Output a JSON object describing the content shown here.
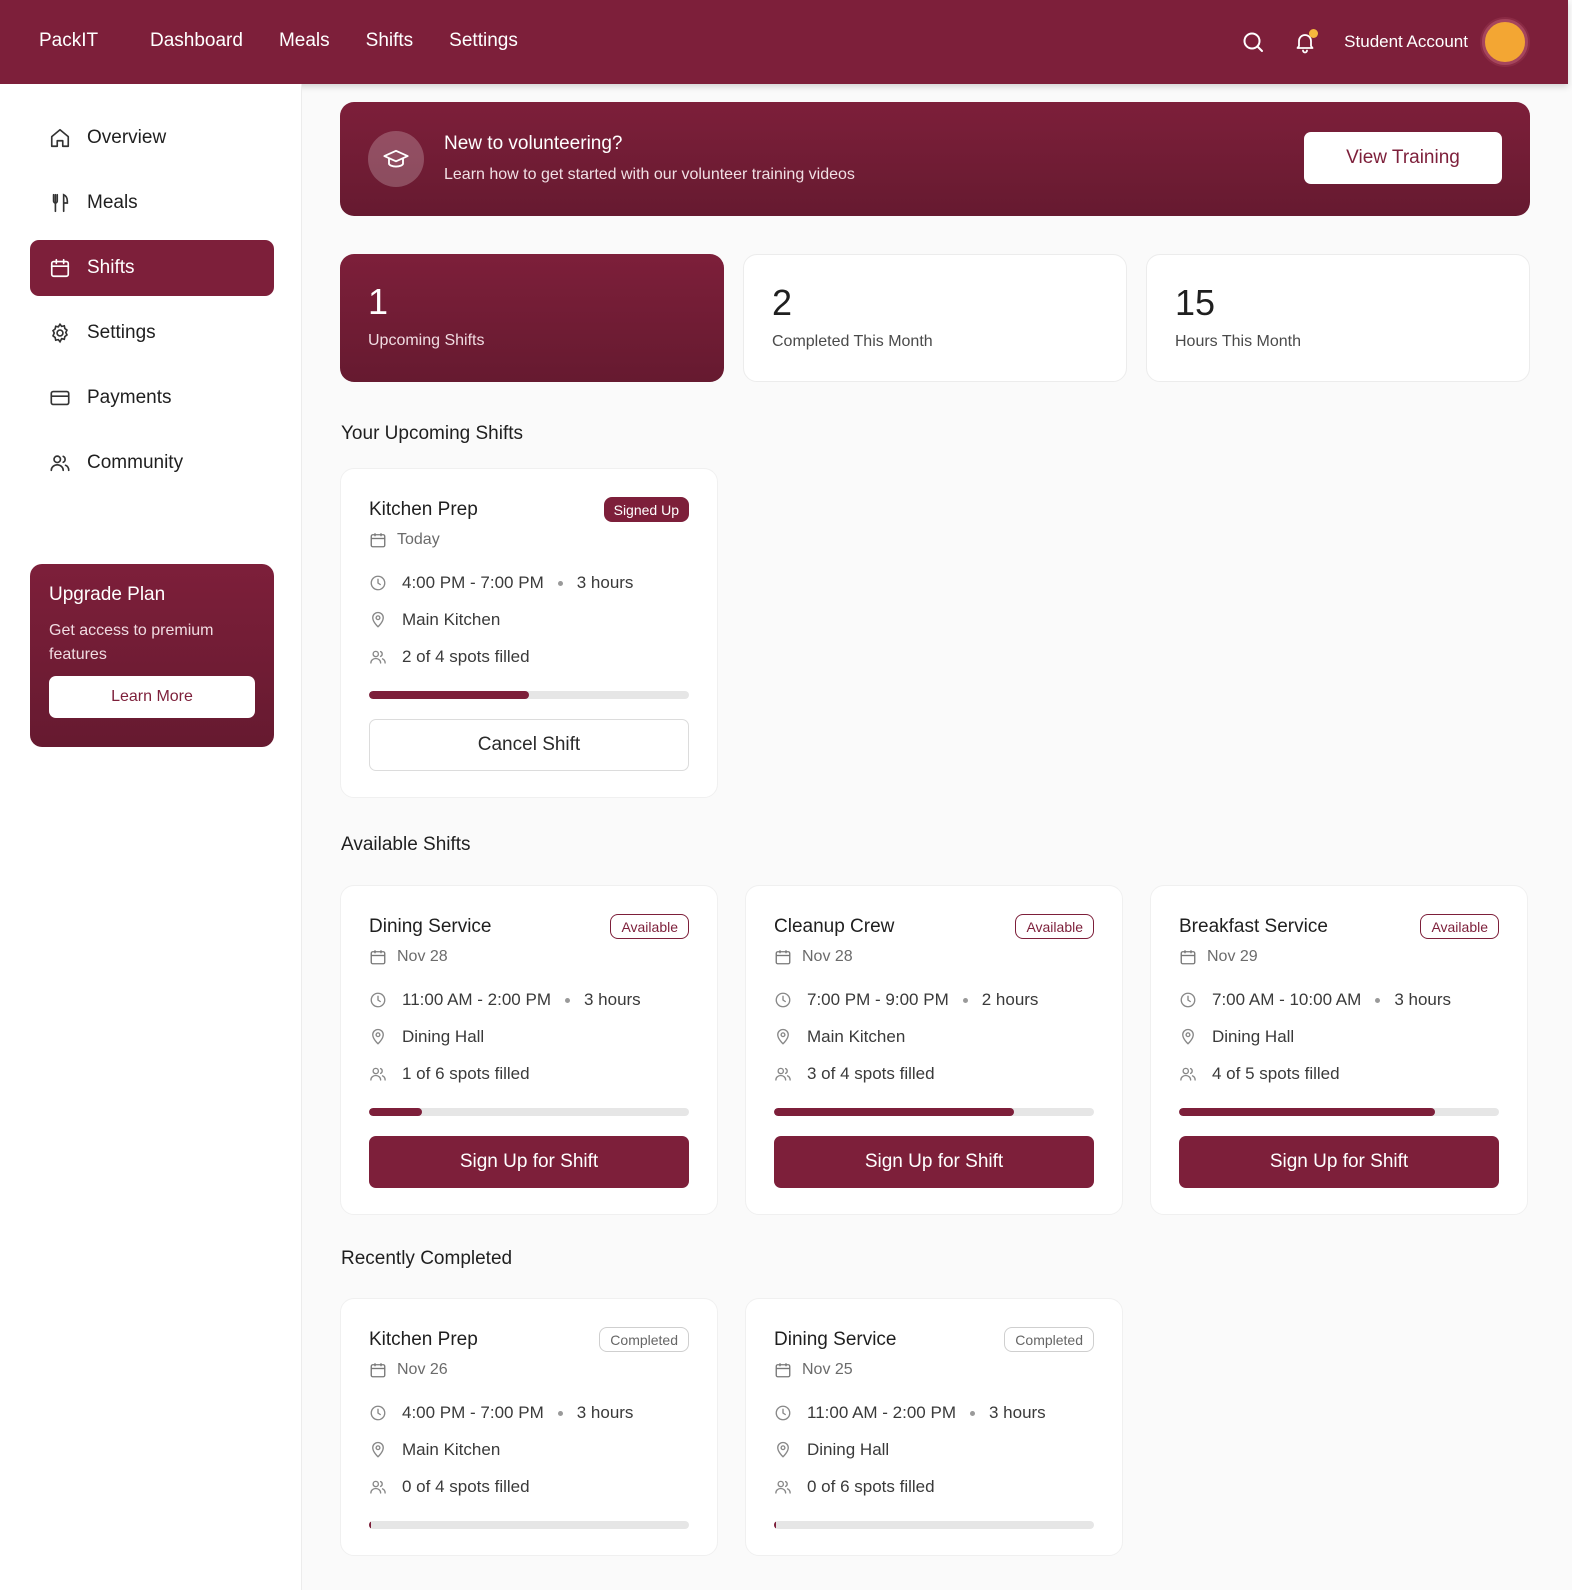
{
  "brand": "PackIT",
  "topnav": [
    "Dashboard",
    "Meals",
    "Shifts",
    "Settings"
  ],
  "account": {
    "name": "Student Account",
    "avatar_color": "#f3a633",
    "notification_dot_color": "#f5b83d"
  },
  "colors": {
    "accent": "#7d1f3a"
  },
  "sidebar": {
    "items": [
      {
        "label": "Overview",
        "icon": "home-icon"
      },
      {
        "label": "Meals",
        "icon": "utensils-icon"
      },
      {
        "label": "Shifts",
        "icon": "calendar-icon",
        "active": true
      },
      {
        "label": "Settings",
        "icon": "gear-icon"
      },
      {
        "label": "Payments",
        "icon": "credit-card-icon"
      },
      {
        "label": "Community",
        "icon": "users-icon"
      }
    ],
    "upgrade": {
      "title": "Upgrade Plan",
      "text": "Get access to premium features",
      "button": "Learn More"
    }
  },
  "banner": {
    "title": "New to volunteering?",
    "subtitle": "Learn how to get started with our volunteer training videos",
    "button": "View Training",
    "icon": "graduation-cap-icon"
  },
  "stats": [
    {
      "value": "1",
      "label": "Upcoming Shifts"
    },
    {
      "value": "2",
      "label": "Completed This Month"
    },
    {
      "value": "15",
      "label": "Hours This Month"
    }
  ],
  "sections": {
    "upcoming": "Your Upcoming Shifts",
    "available": "Available Shifts",
    "completed": "Recently Completed"
  },
  "upcoming_shifts": [
    {
      "title": "Kitchen Prep",
      "badge": "Signed Up",
      "date": "Today",
      "time": "4:00 PM - 7:00 PM",
      "duration": "3 hours",
      "location": "Main Kitchen",
      "spots": "2 of 4 spots filled",
      "fill": 0.5,
      "button": "Cancel Shift"
    }
  ],
  "available_shifts": [
    {
      "title": "Dining Service",
      "badge": "Available",
      "date": "Nov 28",
      "time": "11:00 AM - 2:00 PM",
      "duration": "3 hours",
      "location": "Dining Hall",
      "spots": "1 of 6 spots filled",
      "fill": 0.1667,
      "button": "Sign Up for Shift"
    },
    {
      "title": "Cleanup Crew",
      "badge": "Available",
      "date": "Nov 28",
      "time": "7:00 PM - 9:00 PM",
      "duration": "2 hours",
      "location": "Main Kitchen",
      "spots": "3 of 4 spots filled",
      "fill": 0.75,
      "button": "Sign Up for Shift"
    },
    {
      "title": "Breakfast Service",
      "badge": "Available",
      "date": "Nov 29",
      "time": "7:00 AM - 10:00 AM",
      "duration": "3 hours",
      "location": "Dining Hall",
      "spots": "4 of 5 spots filled",
      "fill": 0.8,
      "button": "Sign Up for Shift"
    }
  ],
  "completed_shifts": [
    {
      "title": "Kitchen Prep",
      "badge": "Completed",
      "date": "Nov 26",
      "time": "4:00 PM - 7:00 PM",
      "duration": "3 hours",
      "location": "Main Kitchen",
      "spots": "0 of 4 spots filled",
      "fill": 0
    },
    {
      "title": "Dining Service",
      "badge": "Completed",
      "date": "Nov 25",
      "time": "11:00 AM - 2:00 PM",
      "duration": "3 hours",
      "location": "Dining Hall",
      "spots": "0 of 6 spots filled",
      "fill": 0
    }
  ]
}
